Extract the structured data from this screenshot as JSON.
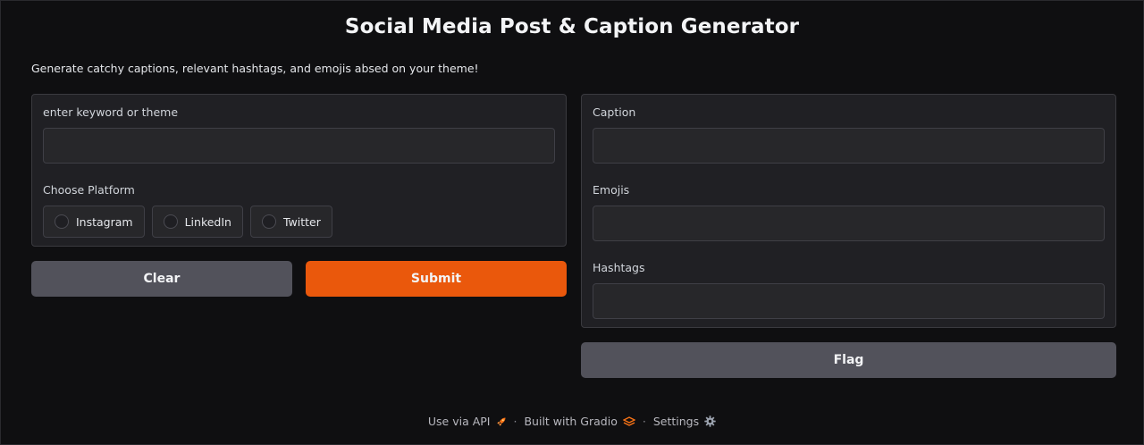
{
  "title": "Social Media Post & Caption Generator",
  "description": "Generate catchy captions, relevant hashtags, and emojis absed on your theme!",
  "inputs": {
    "keyword": {
      "label": "enter keyword or theme",
      "value": ""
    },
    "platform": {
      "label": "Choose Platform",
      "options": [
        "Instagram",
        "LinkedIn",
        "Twitter"
      ],
      "selected": null
    }
  },
  "outputs": {
    "caption": {
      "label": "Caption",
      "value": ""
    },
    "emojis": {
      "label": "Emojis",
      "value": ""
    },
    "hashtags": {
      "label": "Hashtags",
      "value": ""
    }
  },
  "buttons": {
    "clear": "Clear",
    "submit": "Submit",
    "flag": "Flag"
  },
  "footer": {
    "api": "Use via API",
    "built": "Built with Gradio",
    "settings": "Settings",
    "separator": "·"
  },
  "icons": {
    "api": "rocket-icon",
    "gradio": "gradio-logo-icon",
    "settings": "gear-icon"
  },
  "colors": {
    "background": "#0f0f11",
    "panel": "#202024",
    "primary": "#ea580c",
    "secondary": "#52525b"
  }
}
